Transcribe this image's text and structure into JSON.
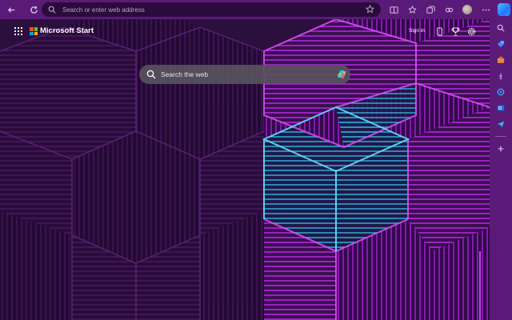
{
  "browser": {
    "address_placeholder": "Search or enter web address",
    "accent": "#5a1b78"
  },
  "header": {
    "brand": "Microsoft Start",
    "signin": "Sign in"
  },
  "search": {
    "placeholder": "Search the web"
  },
  "sidebar": {
    "items": [
      {
        "icon": "search-icon"
      },
      {
        "icon": "tag-icon"
      },
      {
        "icon": "briefcase-icon"
      },
      {
        "icon": "chess-icon"
      },
      {
        "icon": "copilot-icon"
      },
      {
        "icon": "outlook-icon"
      },
      {
        "icon": "send-icon"
      },
      {
        "icon": "add-icon"
      }
    ]
  },
  "colors": {
    "background": "#2b0f3d",
    "magenta": "#b41fe0",
    "cyan": "#3fd6ff"
  }
}
